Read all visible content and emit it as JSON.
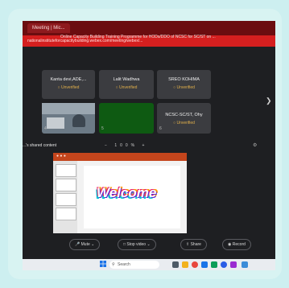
{
  "browser": {
    "tab_label": "Meeting | Mic...",
    "url": "nationalinstituteforcapacitybuilding.webex.com/meeting/webex/..."
  },
  "meeting": {
    "title": "Online Capacity Building Training Programme for HODs/DDO of NCSC for SC/ST on ..."
  },
  "participants": [
    {
      "name": "Kanta devi,ADE,...",
      "status": "Unverified",
      "num": "",
      "kind": "blank"
    },
    {
      "name": "Lalit Wadhwa",
      "status": "Unverified",
      "num": "",
      "kind": "blank"
    },
    {
      "name": "SREO KOHIMA",
      "status": "Unverified",
      "num": "",
      "kind": "blank"
    },
    {
      "name": "",
      "status": "",
      "num": "4",
      "kind": "video"
    },
    {
      "name": "",
      "status": "",
      "num": "5",
      "kind": "green"
    },
    {
      "name": "NCSC-SC/ST, Ohy",
      "status": "Unverified",
      "num": "6",
      "kind": "blank"
    }
  ],
  "shared_content": {
    "label": "...'s shared content",
    "zoom": "100%",
    "slide_text": "Welcome"
  },
  "toolbar": {
    "mute": "Mute",
    "stop_video": "Stop video",
    "share": "Share",
    "record": "Record"
  },
  "taskbar": {
    "search_placeholder": "Search"
  }
}
